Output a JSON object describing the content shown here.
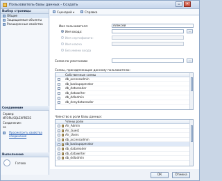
{
  "window": {
    "title": "Пользователь базы данных - Создать"
  },
  "sidebar": {
    "section_title": "Выбор страницы",
    "pages": [
      {
        "label": "Общие",
        "icon": "page-icon"
      },
      {
        "label": "Защищаемые объекты",
        "icon": "page-icon"
      },
      {
        "label": "Расширенные свойства",
        "icon": "page-icon"
      }
    ],
    "connection": {
      "title": "Соединение",
      "server_label": "Сервер:",
      "server_value": "ИГОРЬ\\SQLEXPRESS",
      "connection_label": "Соединение:",
      "connection_value": "sa",
      "link_text": "Просмотреть свойства соединения"
    },
    "progress": {
      "title": "Выполнение",
      "status": "Готово"
    }
  },
  "toolbar": {
    "script_label": "Сценарий",
    "help_label": "Справка"
  },
  "form": {
    "username_label": "Имя пользователя:",
    "username_value": "Алексей",
    "login_radio_label": "Имя входа:",
    "login_value": "",
    "cert_radio_label": "Имя сертификата:",
    "key_radio_label": "Имя ключа",
    "nologin_radio_label": "Без имени входа",
    "default_schema_label": "Схема по умолчанию:",
    "default_schema_value": "",
    "ellipsis": "..."
  },
  "owned_schemas": {
    "title": "Схемы, принадлежащие данному пользователю:",
    "column": "Собственные схемы",
    "rows": [
      "db_accessadmin",
      "db_backupoperator",
      "db_datareader",
      "db_datawriter",
      "db_ddladmin",
      "db_denydatareader"
    ]
  },
  "role_membership": {
    "title": "Членство в роли базы данных:",
    "column": "Члены роли",
    "rows": [
      "Air_Admin",
      "Air_Guest",
      "Air_Users",
      "db_accessadmin",
      "db_backupoperator",
      "db_datareader",
      "db_datawriter",
      "db_ddladmin"
    ]
  },
  "buttons": {
    "ok": "ОК",
    "cancel": "Отмена"
  }
}
